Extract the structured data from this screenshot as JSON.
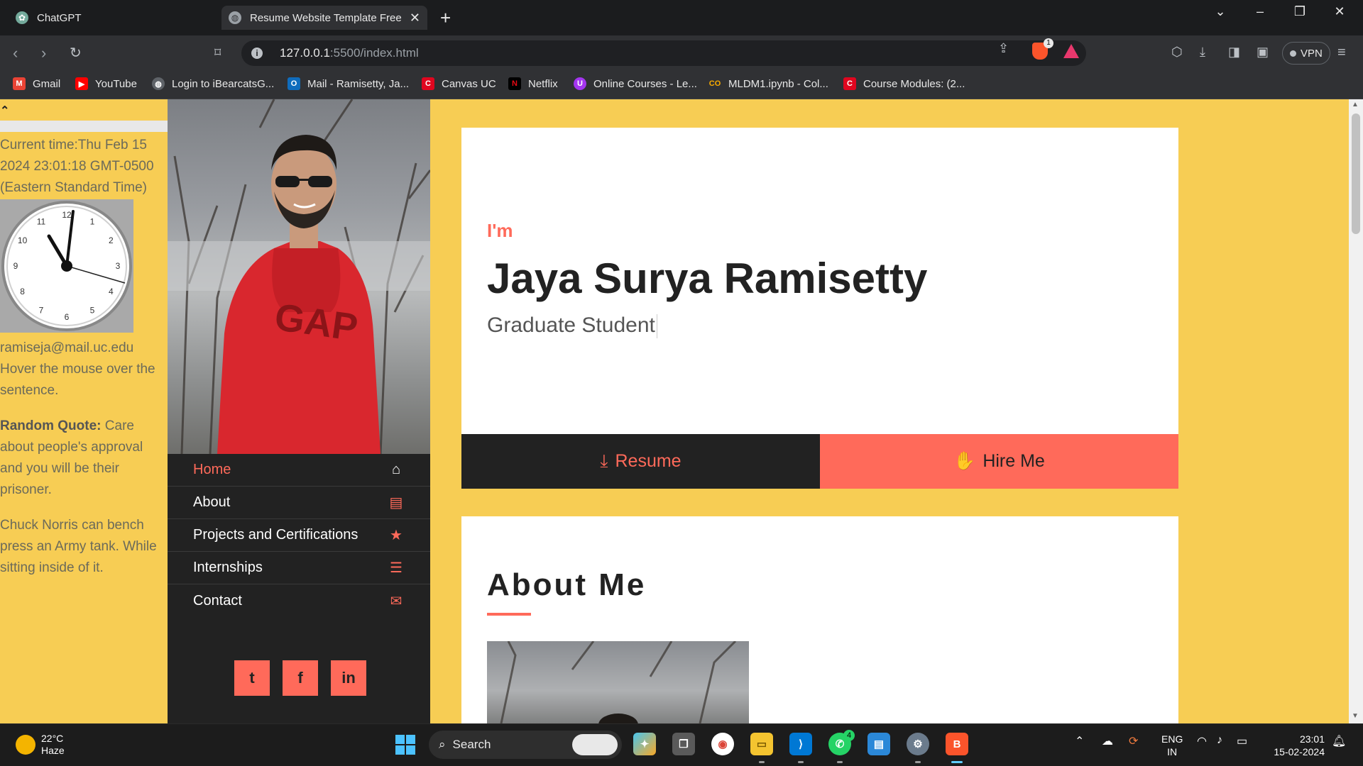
{
  "browser": {
    "tabs": [
      {
        "title": "ChatGPT",
        "active": false
      },
      {
        "title": "Resume Website Template Free",
        "active": true
      }
    ],
    "url_host": "127.0.0.1",
    "url_path": ":5500/index.html",
    "vpn_label": "VPN",
    "shields_badge": "1",
    "bookmarks": [
      {
        "label": "Gmail",
        "icon": "gmail-icon",
        "color": "#ea4335"
      },
      {
        "label": "YouTube",
        "icon": "youtube-icon",
        "color": "#ff0000"
      },
      {
        "label": "Login to iBearcatsG...",
        "icon": "globe-icon",
        "color": "#9aa0a6"
      },
      {
        "label": "Mail - Ramisetty, Ja...",
        "icon": "outlook-icon",
        "color": "#0f6cbd"
      },
      {
        "label": "Canvas UC",
        "icon": "canvas-icon",
        "color": "#e0061f"
      },
      {
        "label": "Netflix",
        "icon": "netflix-icon",
        "color": "#e50914"
      },
      {
        "label": "Online Courses - Le...",
        "icon": "udemy-icon",
        "color": "#a435f0"
      },
      {
        "label": "MLDM1.ipynb - Col...",
        "icon": "colab-icon",
        "color": "#f9ab00"
      },
      {
        "label": "Course Modules: (2...",
        "icon": "canvas-icon",
        "color": "#e0061f"
      }
    ]
  },
  "widgets": {
    "current_time": "Current time:Thu Feb 15 2024 23:01:18 GMT-0500 (Eastern Standard Time)",
    "email": "ramiseja@mail.uc.edu",
    "hover_text": "Hover the mouse over the sentence.",
    "quote_label": "Random Quote:",
    "quote_text": " Care about people's approval and you will be their prisoner.",
    "norris_fact": "Chuck Norris can bench press an Army tank. While sitting inside of it.",
    "clock_numbers": [
      "12",
      "1",
      "2",
      "3",
      "4",
      "5",
      "6",
      "7",
      "8",
      "9",
      "10",
      "11"
    ]
  },
  "sidebar": {
    "nav": [
      {
        "label": "Home",
        "icon": "home-icon",
        "glyph": "⌂",
        "active": true
      },
      {
        "label": "About",
        "icon": "id-card-icon",
        "glyph": "▤",
        "active": false
      },
      {
        "label": "Projects and Certifications",
        "icon": "star-icon",
        "glyph": "★",
        "active": false
      },
      {
        "label": "Internships",
        "icon": "list-icon",
        "glyph": "☰",
        "active": false
      },
      {
        "label": "Contact",
        "icon": "envelope-icon",
        "glyph": "✉",
        "active": false
      }
    ],
    "socials": [
      {
        "name": "twitter",
        "glyph": "t"
      },
      {
        "name": "facebook",
        "glyph": "f"
      },
      {
        "name": "linkedin",
        "glyph": "in"
      }
    ]
  },
  "hero": {
    "intro": "I'm",
    "name": "Jaya Surya Ramisetty",
    "role": "Graduate Student"
  },
  "buttons": {
    "resume": "Resume",
    "hire": "Hire Me"
  },
  "about": {
    "heading": "About Me"
  },
  "taskbar": {
    "temperature": "22°C",
    "condition": "Haze",
    "search_placeholder": "Search",
    "lang_line1": "ENG",
    "lang_line2": "IN",
    "time": "23:01",
    "date": "15-02-2024",
    "whatsapp_badge": "4"
  },
  "colors": {
    "accent": "#ff6a5a",
    "background": "#f7cd54",
    "dark": "#222222"
  }
}
